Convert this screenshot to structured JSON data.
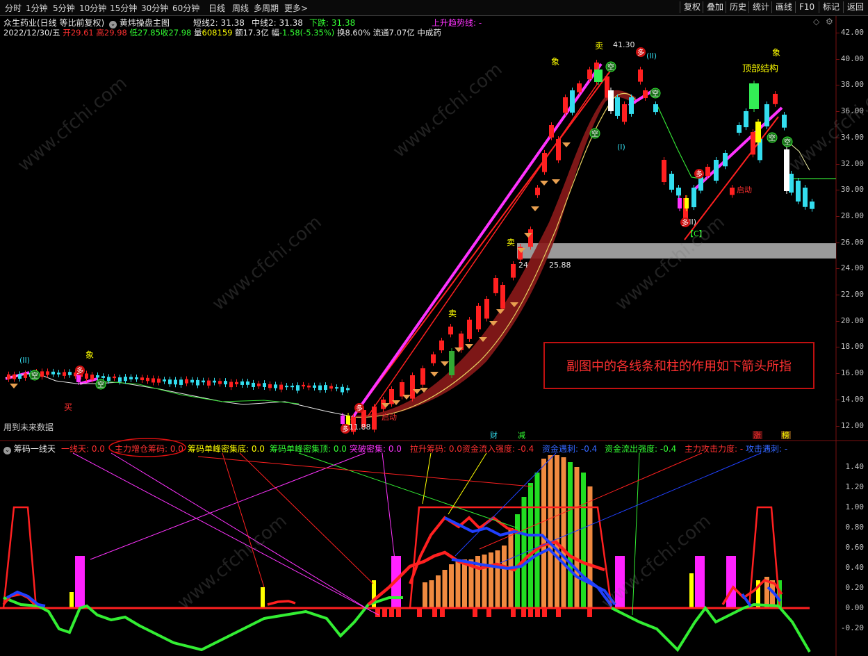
{
  "toolbar": {
    "periods": [
      "分时",
      "1分钟",
      "5分钟",
      "10分钟",
      "15分钟",
      "30分钟",
      "60分钟",
      "日线",
      "周线",
      "多周期",
      "更多>"
    ],
    "active_period": "日线",
    "right_buttons": [
      "复权",
      "叠加",
      "历史",
      "统计",
      "画线",
      "F10",
      "标记",
      "返回"
    ]
  },
  "main_header": {
    "stock": "众生药业(日线 等比前复权)",
    "indicator": "黄炜操盘主图",
    "short_line": "短线2: 31.38",
    "mid_line": "中线2: 31.38",
    "down_line": "下跌: 31.38",
    "trend_line": "上升趋势线: -"
  },
  "quote": {
    "date": "2022/12/30/五",
    "open_label": "开",
    "open": "29.61",
    "high_label": "高",
    "high": "29.98",
    "low_label": "低",
    "low": "27.85",
    "close_label": "收",
    "close": "27.98",
    "volume_label": "量",
    "volume": "608159",
    "amount_label": "额",
    "amount": "17.3亿",
    "change_label": "幅",
    "change": "-1.58(-5.35%)",
    "turnover_label": "换",
    "turnover": "8.60%",
    "float_label": "流通",
    "float": "7.07亿",
    "sector": "中成药"
  },
  "main_chart": {
    "price_axis": [
      "42.00",
      "40.00",
      "38.00",
      "36.00",
      "34.00",
      "32.00",
      "30.00",
      "28.00",
      "26.00",
      "24.00",
      "22.00",
      "20.00",
      "18.00",
      "16.00",
      "14.00",
      "12.00"
    ],
    "peak_label": "41.30",
    "zone_label_left": "24",
    "zone_label_right": "25.88",
    "low_label": "11.88",
    "future_data_note": "用到未来数据",
    "top_structure_label": "顶部结构",
    "markers": {
      "buy": "买",
      "sell": "卖",
      "empty": "空",
      "like": "象",
      "many": "多",
      "start": "启动",
      "wave_I": "(I)",
      "wave_II": "(II)",
      "wave_C": "【C】",
      "cai": "财",
      "jian": "减",
      "zhang": "涨",
      "bang": "榜"
    },
    "annotation": "副图中的各线条和柱的作用如下箭头所指",
    "colors": {
      "up": "#ff2020",
      "down": "#33ddee",
      "trend": "#ff33ff",
      "band": "#8b1a1a"
    }
  },
  "sub_header": {
    "indicator": "筹码一线天",
    "items": [
      {
        "text": "一线天: 0.0",
        "color": "#ff3030"
      },
      {
        "text": "主力增仓筹码: 0.0",
        "color": "#ff3030"
      },
      {
        "text": "筹码单峰密集底: 0.0",
        "color": "#ffff00"
      },
      {
        "text": "筹码单峰密集顶: 0.0",
        "color": "#33ff33"
      },
      {
        "text": "突破密集: 0.0",
        "color": "#ff33ff"
      },
      {
        "text": "拉升筹码: 0.0",
        "color": "#ff3030"
      },
      {
        "text": "资金流入强度: -0.4",
        "color": "#ff3030"
      },
      {
        "text": "资金遇刺: -0.4",
        "color": "#3366ff"
      },
      {
        "text": "资金流出强度: -0.4",
        "color": "#33ff33"
      },
      {
        "text": "主力攻击力度: -",
        "color": "#ff3030"
      },
      {
        "text": "攻击遇刺: -",
        "color": "#3366ff"
      }
    ]
  },
  "sub_chart": {
    "axis": [
      "1.40",
      "1.20",
      "1.00",
      "0.80",
      "0.60",
      "0.40",
      "0.20",
      "0.00",
      "-0.20"
    ]
  }
}
